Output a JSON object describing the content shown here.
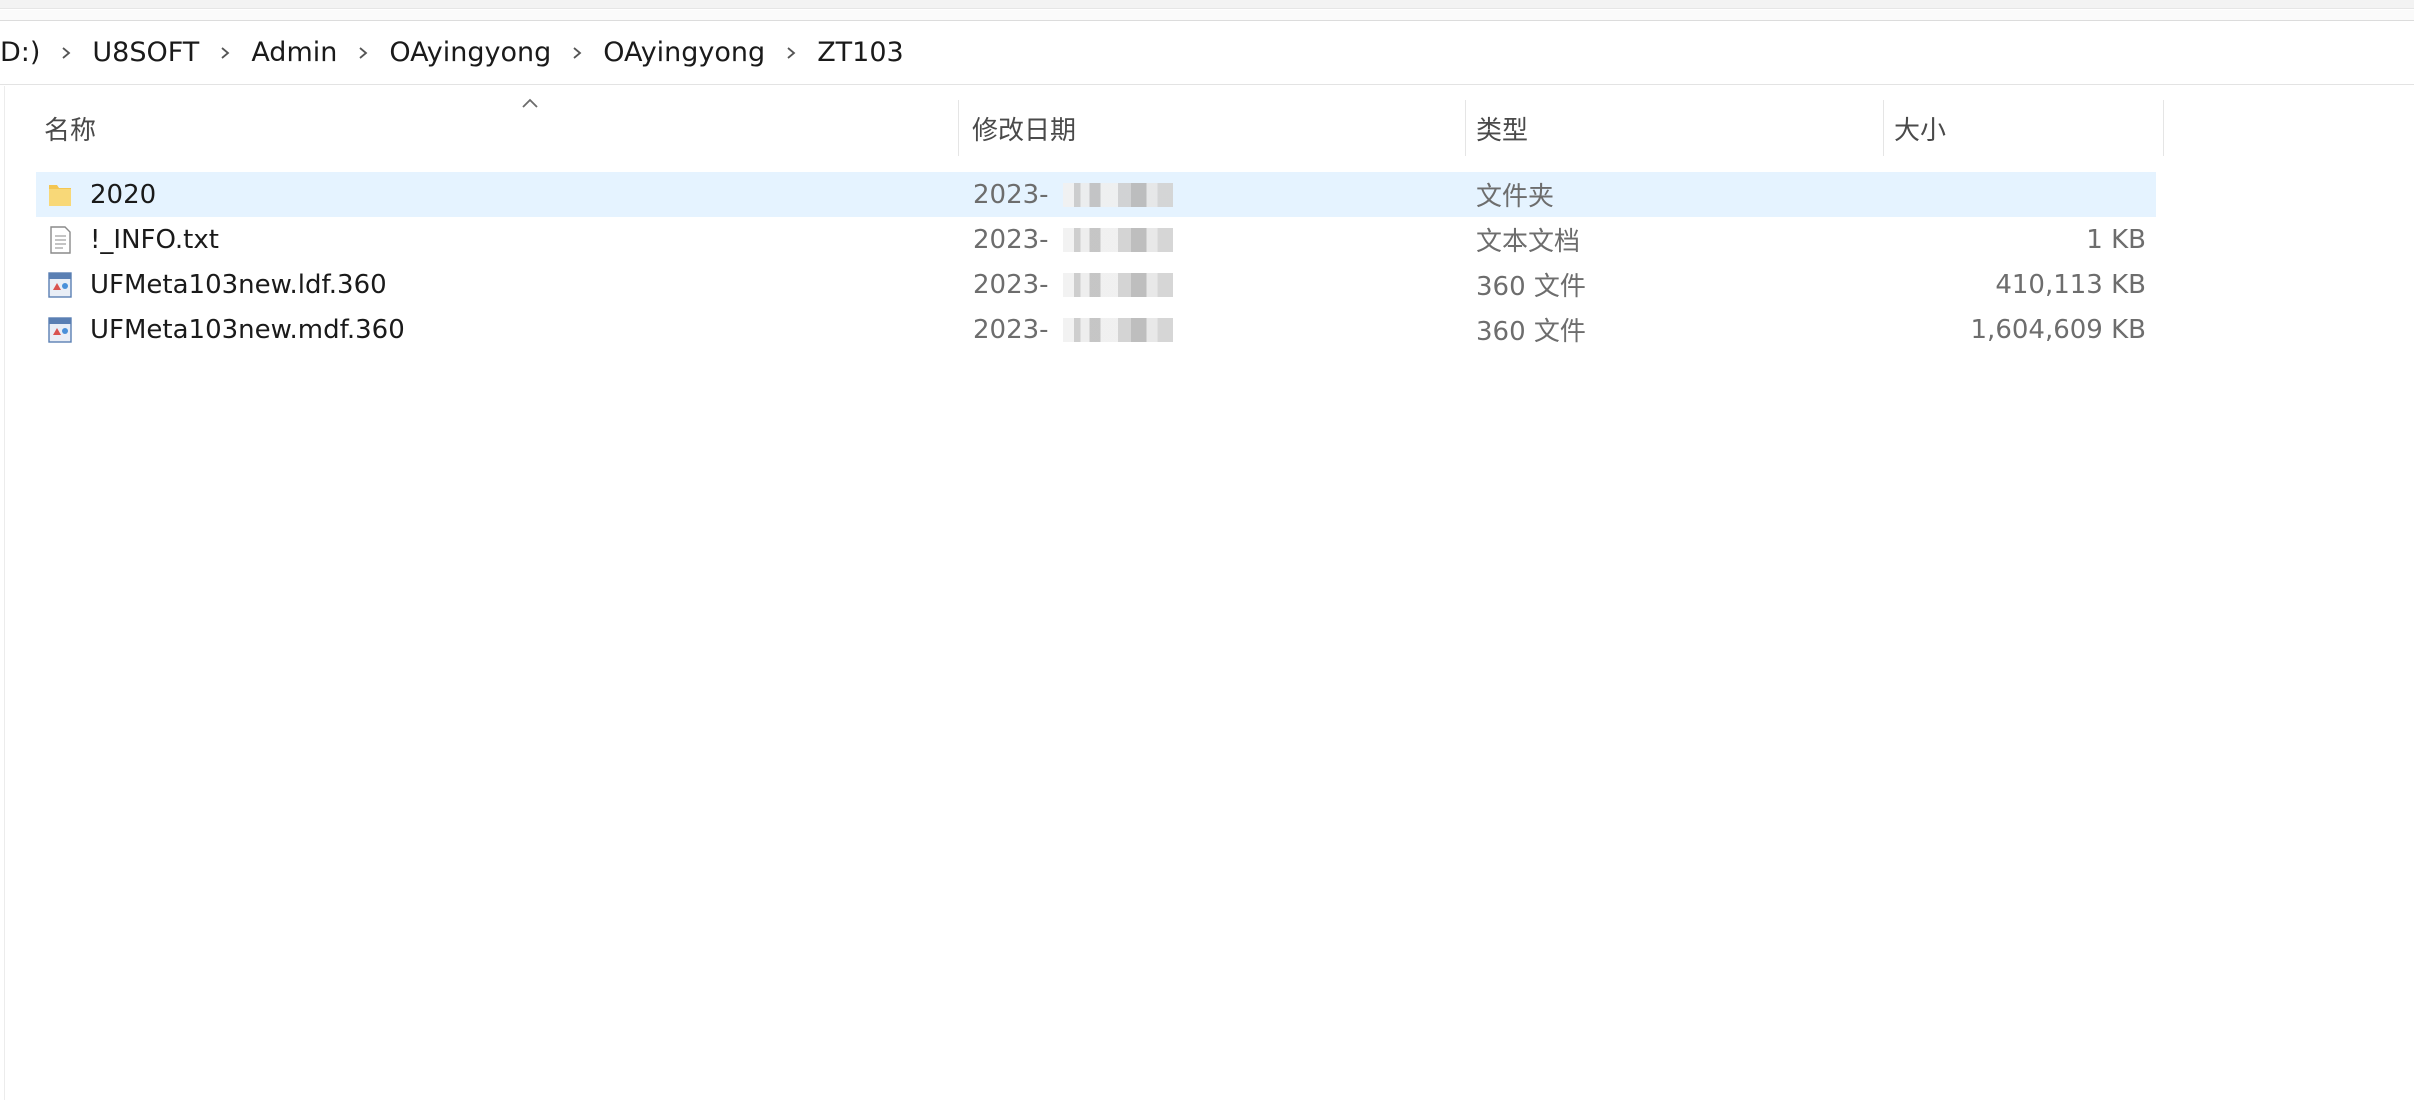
{
  "breadcrumb": {
    "items": [
      "D:)",
      "U8SOFT",
      "Admin",
      "OAyingyong",
      "OAyingyong",
      "ZT103"
    ]
  },
  "columns": {
    "name": "名称",
    "date": "修改日期",
    "type": "类型",
    "size": "大小"
  },
  "files": [
    {
      "name": "2020",
      "date": "2023-",
      "type": "文件夹",
      "size": "",
      "icon": "folder-icon",
      "selected": true
    },
    {
      "name": "!_INFO.txt",
      "date": "2023-",
      "type": "文本文档",
      "size": "1 KB",
      "icon": "text-file-icon",
      "selected": false
    },
    {
      "name": "UFMeta103new.ldf.360",
      "date": "2023-",
      "type": "360 文件",
      "size": "410,113 KB",
      "icon": "file-360-icon",
      "selected": false
    },
    {
      "name": "UFMeta103new.mdf.360",
      "date": "2023-",
      "type": "360 文件",
      "size": "1,604,609 KB",
      "icon": "file-360-icon",
      "selected": false
    }
  ],
  "colors": {
    "selection": "#e5f3ff",
    "folder": "#f4c652",
    "secondary_text": "#6d6d6d"
  }
}
